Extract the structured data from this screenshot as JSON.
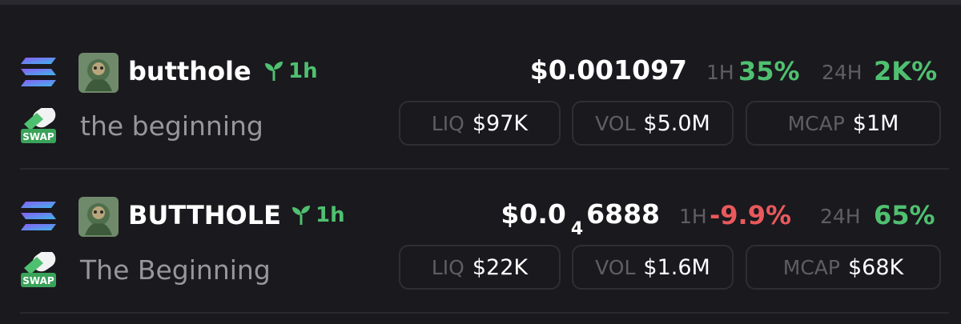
{
  "tokens": [
    {
      "symbol": "butthole",
      "age": "1h",
      "name": "the beginning",
      "price": {
        "prefix": "$0.001097",
        "zeros": "",
        "rest": ""
      },
      "change_1h_label": "1H",
      "change_1h": "35%",
      "change_24h_label": "24H",
      "change_24h": "2K%",
      "stats": [
        {
          "label": "LIQ",
          "value": "$97K"
        },
        {
          "label": "VOL",
          "value": "$5.0M"
        },
        {
          "label": "MCAP",
          "value": "$1M"
        }
      ]
    },
    {
      "symbol": "BUTTHOLE",
      "age": "1h",
      "name": "The Beginning",
      "price": {
        "prefix": "$0.0",
        "zeros": "4",
        "rest": "6888"
      },
      "change_1h_label": "1H",
      "change_1h": "-9.9%",
      "change_24h_label": "24H",
      "change_24h": "65%",
      "stats": [
        {
          "label": "LIQ",
          "value": "$22K"
        },
        {
          "label": "VOL",
          "value": "$1.6M"
        },
        {
          "label": "MCAP",
          "value": "$68K"
        }
      ]
    }
  ],
  "icons": {
    "chain": "solana-icon",
    "swap": "swap-icon",
    "age": "seedling-icon",
    "avatar": "token-avatar"
  },
  "swap_badge_text": "SWAP",
  "colors": {
    "background": "#1a191e",
    "positive": "#4fc070",
    "negative": "#e9595c",
    "muted": "#5f5e64",
    "name": "#97969c"
  }
}
